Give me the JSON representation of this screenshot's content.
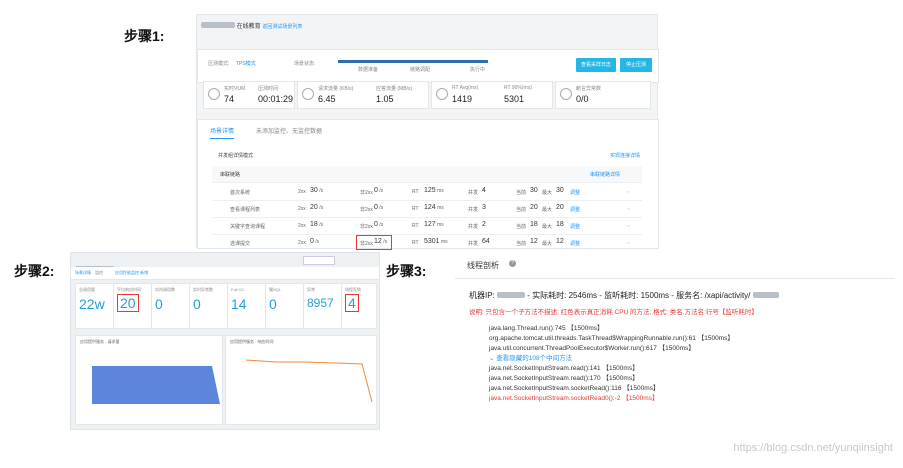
{
  "steps": {
    "s1": "步骤1:",
    "s2": "步骤2:",
    "s3": "步骤3:"
  },
  "panel1": {
    "title_suffix": "在线教育",
    "title_link": "返回测试场景列表",
    "mode_label": "压测模式:",
    "mode_value": "TPS模式",
    "scene_label": "场景状态:",
    "progress_steps": [
      "数据准备",
      "链路调配",
      "执行中"
    ],
    "btn_report": "查看采样日志",
    "btn_stop": "停止压测",
    "metrics": [
      {
        "label": "实时VUM",
        "value": "74"
      },
      {
        "label": "压测时间",
        "value": "00:01:29"
      },
      {
        "label": "请求流量 (KB/s)",
        "value": "6.45"
      },
      {
        "label": "应答流量 (MB/s)",
        "value": "1.05"
      },
      {
        "label": "RT Avg(ms)",
        "value": "1419"
      },
      {
        "label": "RT 90%(ms)",
        "value": "5301"
      },
      {
        "label": "断言异常数",
        "value": "0/0"
      }
    ],
    "tabs": [
      "场景详情",
      "未添加监控、无监控数据"
    ],
    "section_title": "并发组详情模式",
    "section_link": "实现连接详情",
    "sub_title": "串联链路",
    "sub_link": "串联链路详情",
    "rows": [
      {
        "name": "首次系统",
        "tps": "30",
        "tps_unit": "/s",
        "ratio": "0",
        "ratio_unit": "/s",
        "rt": "125",
        "rt_unit": "ms",
        "conc": "4",
        "cur": "30",
        "max": "30",
        "link": "调整"
      },
      {
        "name": "查看课程列表",
        "tps": "20",
        "tps_unit": "/s",
        "ratio": "0",
        "ratio_unit": "/s",
        "rt": "124",
        "rt_unit": "ms",
        "conc": "3",
        "cur": "20",
        "max": "20",
        "link": "调整"
      },
      {
        "name": "关键字查询课程",
        "tps": "18",
        "tps_unit": "/s",
        "ratio": "0",
        "ratio_unit": "/s",
        "rt": "127",
        "rt_unit": "ms",
        "conc": "2",
        "cur": "18",
        "max": "18",
        "link": "调整"
      },
      {
        "name": "选课提交",
        "tps": "0",
        "tps_unit": "/s",
        "ratio": "12",
        "ratio_unit": "/s",
        "rt": "5301",
        "rt_unit": "ms",
        "conc": "64",
        "cur": "12",
        "max": "12",
        "link": "调整"
      }
    ],
    "col_tps": "2xx",
    "col_ratio": "非2xx",
    "col_rt": "RT",
    "col_conc": "并发",
    "col_cur": "当前",
    "col_max": "最大"
  },
  "panel2": {
    "tabs": [
      "场景详情",
      "监控",
      "应用性能监控 新增"
    ],
    "search_placeholder": "",
    "metrics": [
      {
        "label": "总调用量",
        "value": "22w"
      },
      {
        "label": "平均响应时间",
        "value": "20"
      },
      {
        "label": "实时调用数",
        "value": "0"
      },
      {
        "label": "实时异常数",
        "value": "0"
      },
      {
        "label": "Full GC",
        "value": "14"
      },
      {
        "label": "慢SQL",
        "value": "0"
      },
      {
        "label": "异常",
        "value": "8957"
      },
      {
        "label": "线程死锁",
        "value": "4"
      }
    ],
    "chart_left_title": "应用提供服务 - 请求量",
    "chart_right_title": "应用提供服务 - 响应时间"
  },
  "panel3": {
    "title": "线程剖析",
    "summary_prefix": "机器IP:",
    "summary_rest": "- 实际耗时: 2546ms - 监听耗时: 1500ms - 服务名: /xapi/activity/",
    "note": "说明: 只包含一个子方法不描述; 红色表示真正消耗 CPU 的方法; 格式: 类名.方法名:行号【监听耗时】",
    "stack": [
      {
        "text": "java.lang.Thread.run():745 【1500ms】",
        "red": false
      },
      {
        "text": "org.apache.tomcat.util.threads.TaskThread$WrappingRunnable.run():61 【1500ms】",
        "red": false
      },
      {
        "text": "java.util.concurrent.ThreadPoolExecutor$Worker.run():617 【1500ms】",
        "red": false
      },
      {
        "text": "查看隐藏的108个中间方法",
        "red": false,
        "toggle": true
      },
      {
        "text": "java.net.SocketInputStream.read():141 【1500ms】",
        "red": false
      },
      {
        "text": "java.net.SocketInputStream.read():170 【1500ms】",
        "red": false
      },
      {
        "text": "java.net.SocketInputStream.socketRead():116 【1500ms】",
        "red": false
      },
      {
        "text": "java.net.SocketInputStream.socketRead0():-2 【1500ms】",
        "red": true
      }
    ]
  },
  "watermark": "https://blog.csdn.net/yunqiinsight",
  "colors": {
    "accent": "#23b7e5",
    "highlight": "#e53935",
    "chart_fill": "#4a78d8"
  }
}
